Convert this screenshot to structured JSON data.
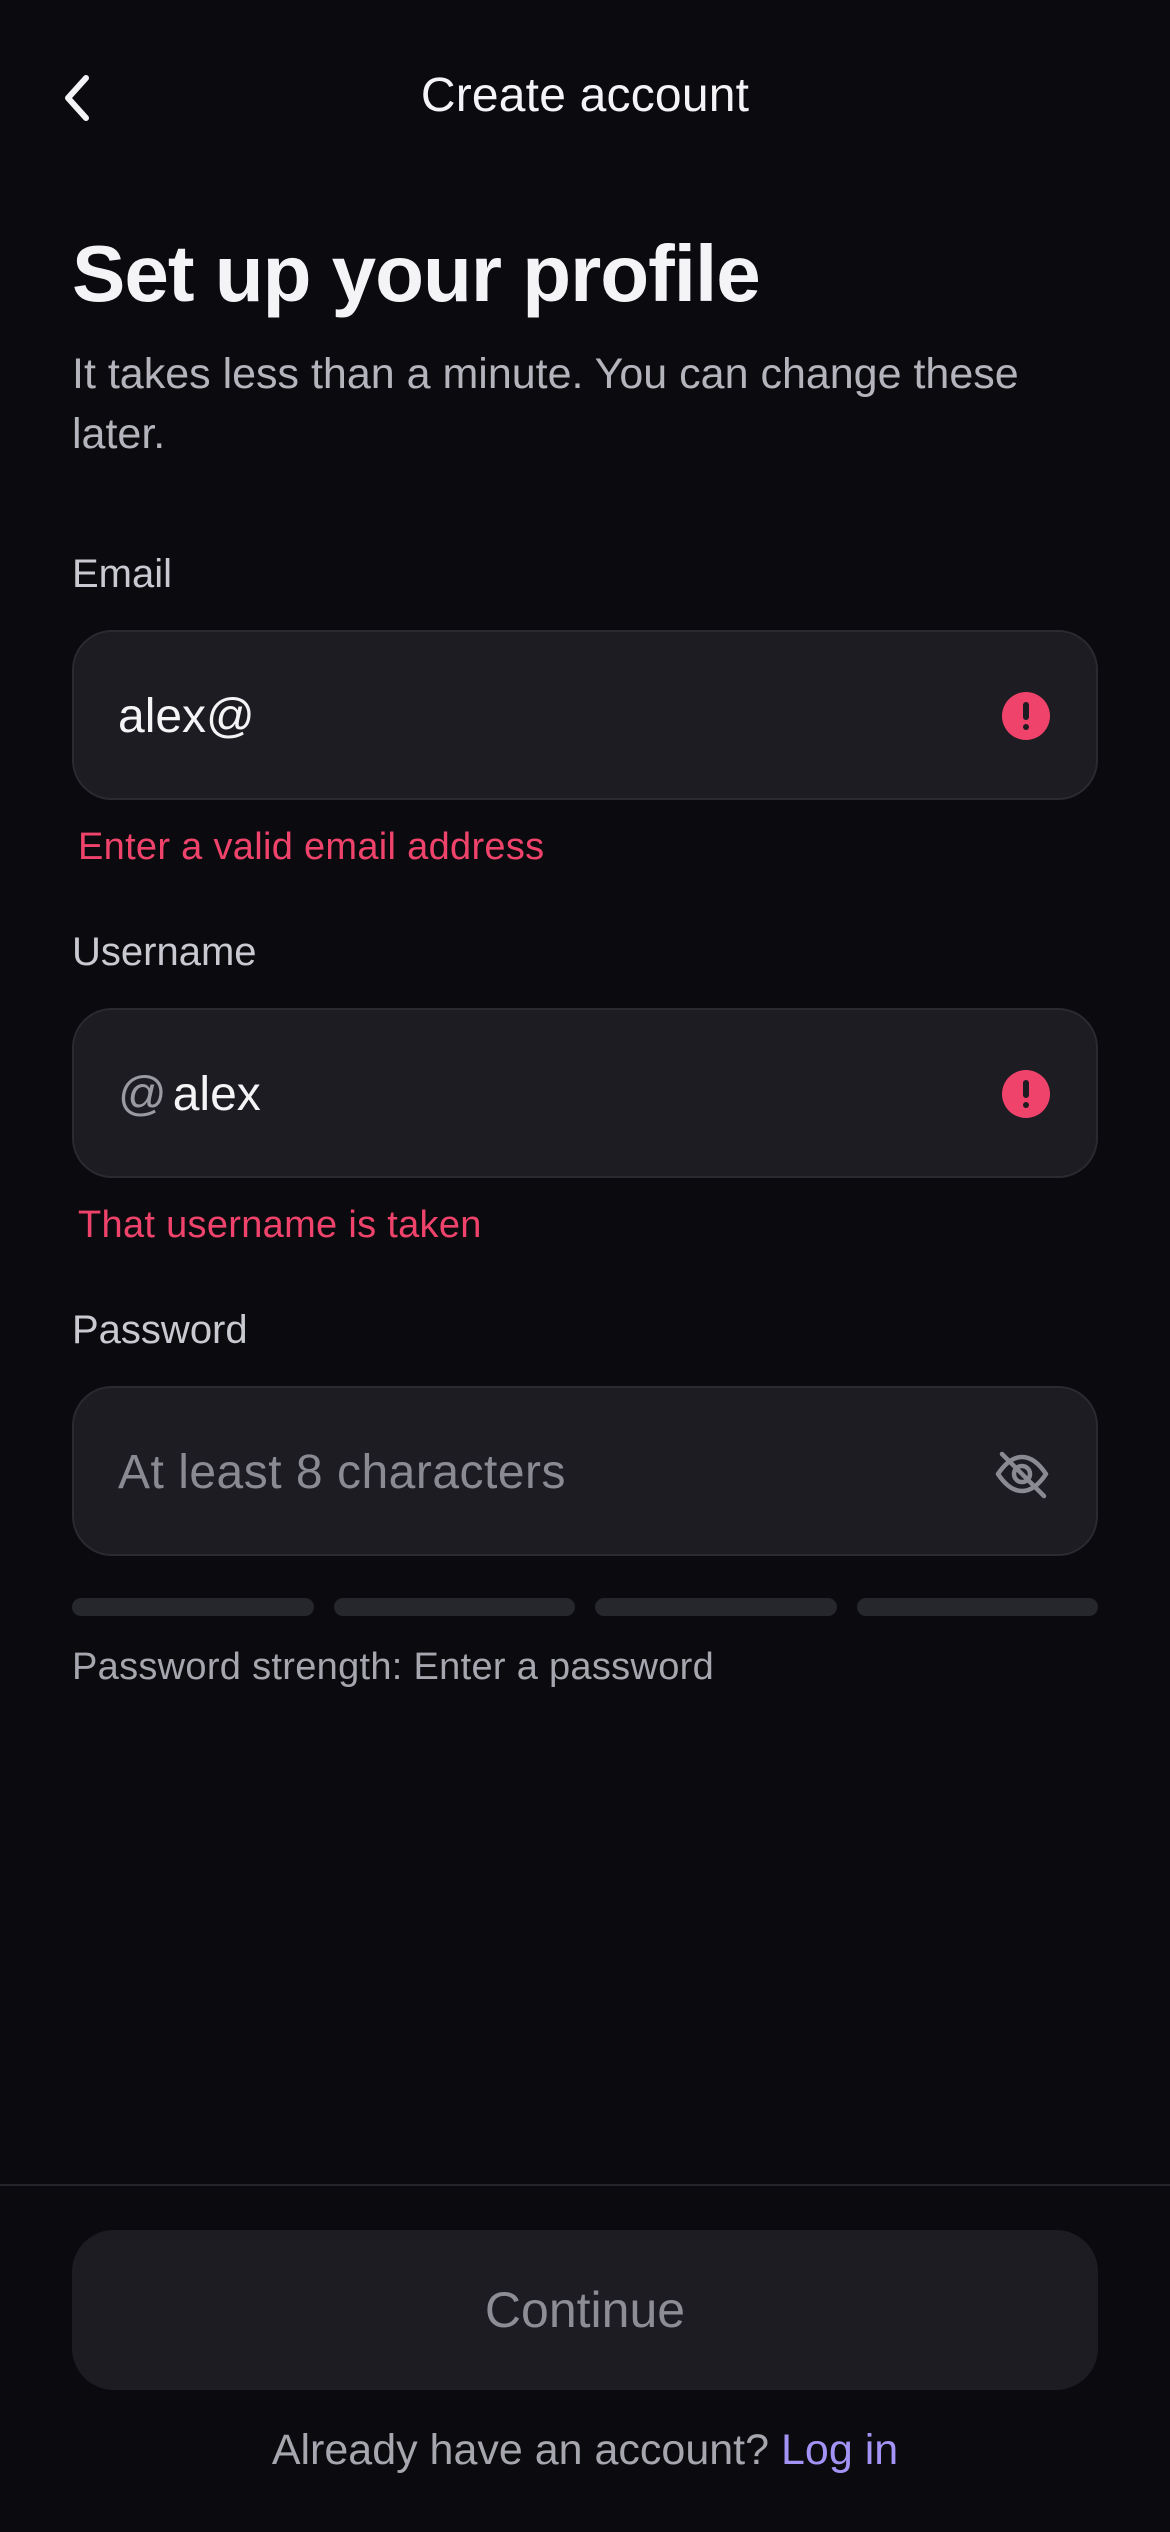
{
  "header": {
    "back_icon": "chevron-left-icon",
    "title": "Create account"
  },
  "intro": {
    "title": "Set up your profile",
    "subtitle": "It takes less than a minute. You can change these later."
  },
  "fields": {
    "email": {
      "label": "Email",
      "value": "alex@",
      "status_icon": "error-icon",
      "error": "Enter a valid email address"
    },
    "username": {
      "label": "Username",
      "prefix": "@",
      "value": "alex",
      "status_icon": "error-icon",
      "error": "That username is taken"
    },
    "password": {
      "label": "Password",
      "value": "",
      "placeholder": "At least 8 characters",
      "toggle_icon": "eye-off-icon",
      "strength_text": "Password strength: Enter a password",
      "strength_level": 0,
      "strength_segments": 4
    }
  },
  "footer": {
    "continue_label": "Continue",
    "login_prompt": "Already have an account?",
    "login_link": "Log in"
  },
  "colors": {
    "background": "#0b0b0f",
    "field_background": "#1c1c22",
    "error": "#f0436b",
    "link": "#a393f5"
  }
}
